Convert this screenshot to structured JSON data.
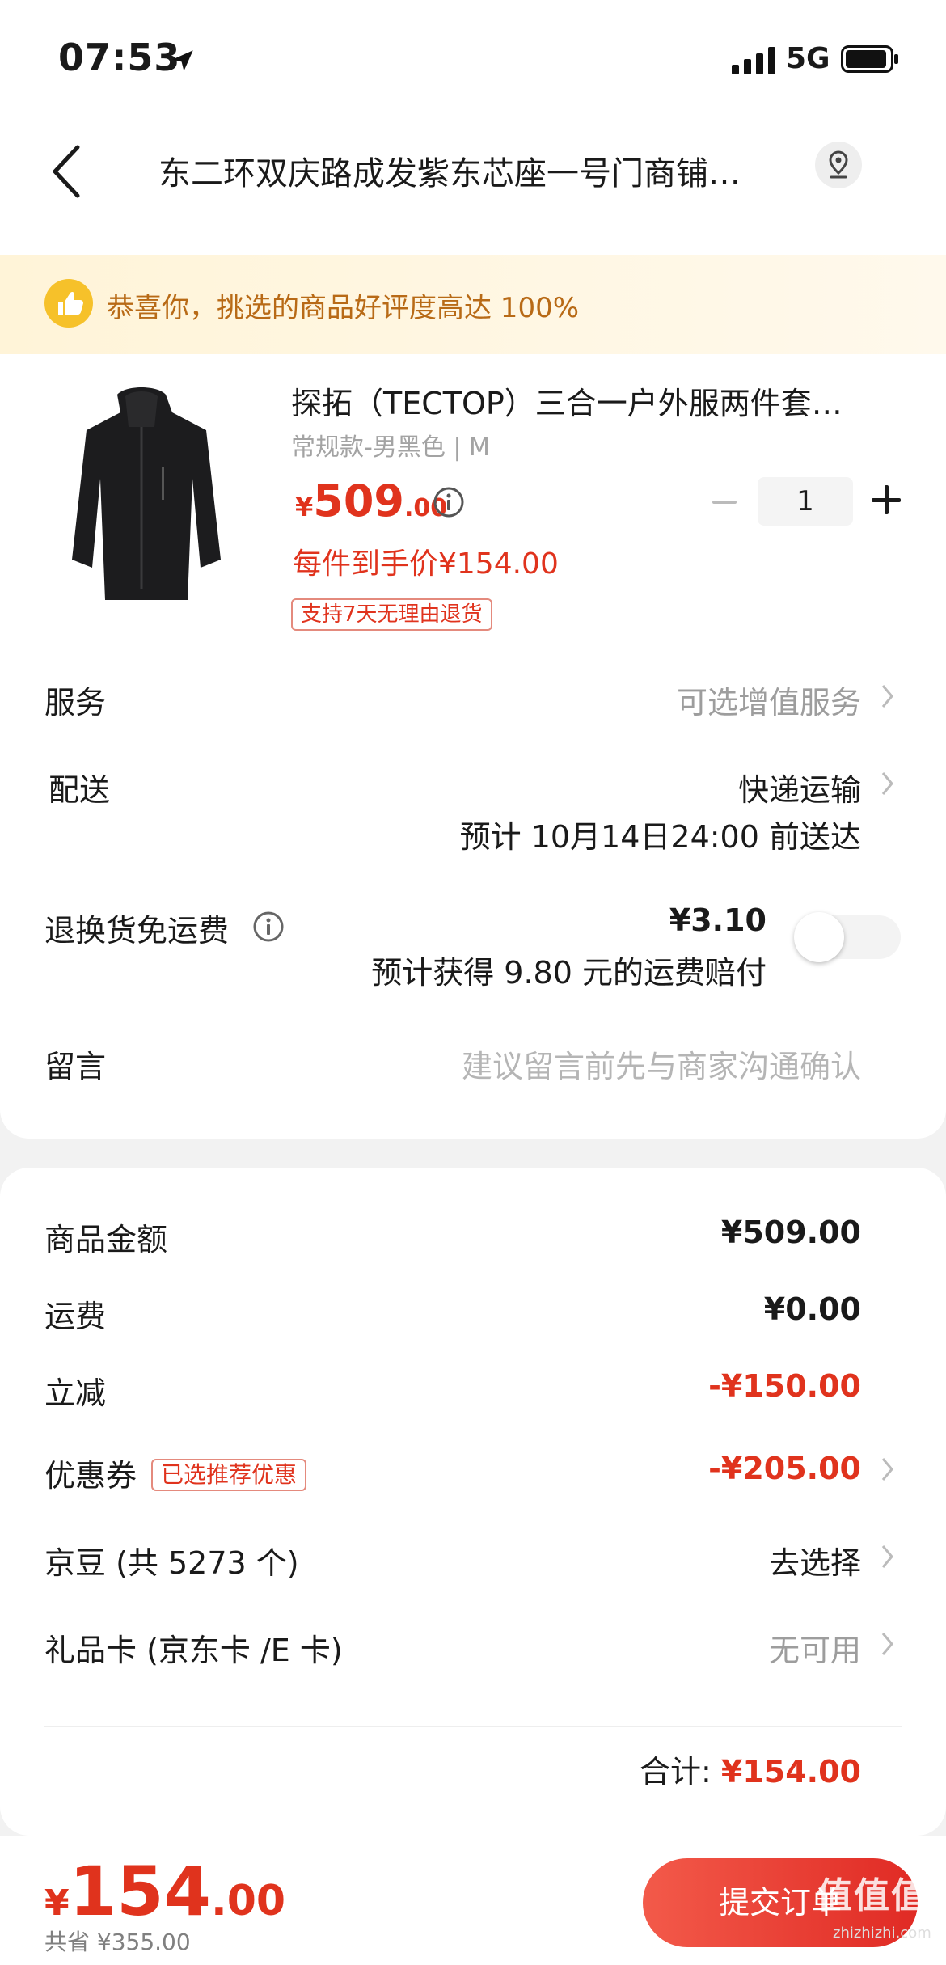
{
  "status_bar": {
    "time": "07:53",
    "network": "5G"
  },
  "nav": {
    "address": "东二环双庆路成发紫东芯座一号门商铺…"
  },
  "banner": {
    "text": "恭喜你，挑选的商品好评度高达 100%"
  },
  "product": {
    "title": "探拓（TECTOP）三合一户外服两件套…",
    "spec": "常规款-男黑色 | M",
    "price_currency": "¥",
    "price_int": "509",
    "price_dec": ".00",
    "quantity": "1",
    "hand_price": "每件到手价¥154.00",
    "return_tag": "支持7天无理由退货"
  },
  "rows": {
    "service": {
      "label": "服务",
      "value": "可选增值服务"
    },
    "delivery": {
      "label": "配送",
      "value": "快递运输",
      "eta": "预计 10月14日24:00 前送达"
    },
    "return_insurance": {
      "label": "退换货免运费",
      "price": "¥3.10",
      "desc": "预计获得 9.80 元的运费赔付",
      "enabled": false
    },
    "note": {
      "label": "留言",
      "placeholder": "建议留言前先与商家沟通确认"
    }
  },
  "summary": {
    "goods_amount": {
      "label": "商品金额",
      "value": "¥509.00"
    },
    "shipping": {
      "label": "运费",
      "value": "¥0.00"
    },
    "instant_discount": {
      "label": "立减",
      "value": "-¥150.00"
    },
    "coupon": {
      "label": "优惠券",
      "tag": "已选推荐优惠",
      "value": "-¥205.00"
    },
    "jingdou": {
      "label": "京豆 (共 5273 个)",
      "value": "去选择"
    },
    "gift_card": {
      "label": "礼品卡 (京东卡 /E 卡)",
      "value": "无可用"
    },
    "total_label": "合计:",
    "total_value": "¥154.00"
  },
  "bottom_bar": {
    "currency": "¥",
    "total_int": "154",
    "total_dec": ".00",
    "saved": "共省 ¥355.00",
    "submit_label": "提交订单"
  },
  "watermark": {
    "text": "值值值",
    "sub": "zhizhizhi.com"
  },
  "colors": {
    "accent_red": "#e0331d",
    "banner_bg": "#fff4d8",
    "banner_text": "#b86a16"
  }
}
